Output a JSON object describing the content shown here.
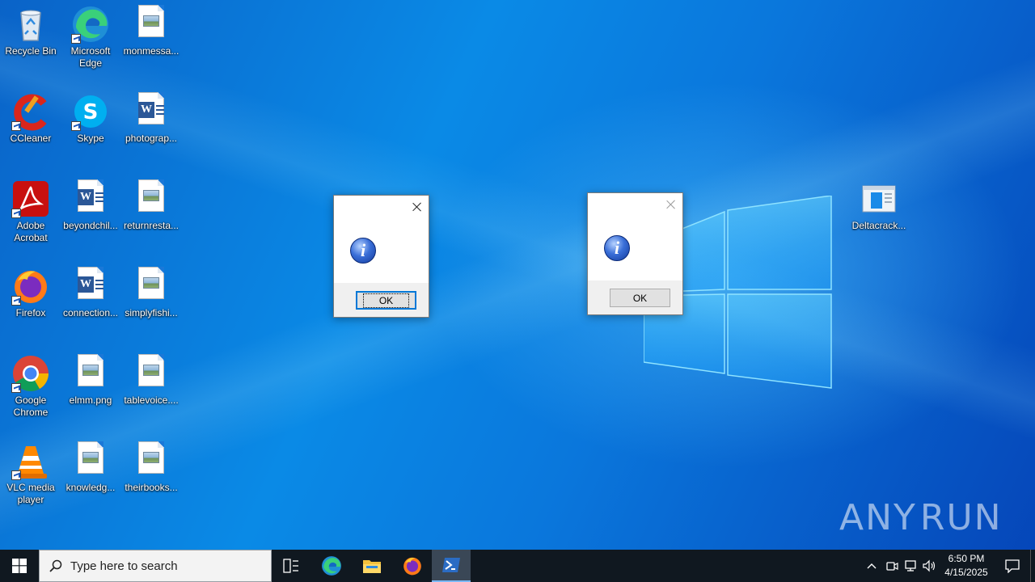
{
  "desktop": {
    "icons": [
      {
        "label": "Recycle Bin",
        "icon": "recycle-bin-icon"
      },
      {
        "label": "Microsoft Edge",
        "icon": "edge-icon"
      },
      {
        "label": "monmessa...",
        "icon": "image-file-icon"
      },
      {
        "label": "CCleaner",
        "icon": "ccleaner-icon"
      },
      {
        "label": "Skype",
        "icon": "skype-icon"
      },
      {
        "label": "photograp...",
        "icon": "word-doc-icon"
      },
      {
        "label": "Adobe Acrobat",
        "icon": "acrobat-icon"
      },
      {
        "label": "beyondchil...",
        "icon": "word-doc-icon"
      },
      {
        "label": "returnresta...",
        "icon": "image-file-icon"
      },
      {
        "label": "Firefox",
        "icon": "firefox-icon"
      },
      {
        "label": "connection...",
        "icon": "word-doc-icon"
      },
      {
        "label": "simplyfishi...",
        "icon": "image-file-icon"
      },
      {
        "label": "Google Chrome",
        "icon": "chrome-icon"
      },
      {
        "label": "elmm.png",
        "icon": "image-file-icon"
      },
      {
        "label": "tablevoice....",
        "icon": "image-file-icon"
      },
      {
        "label": "VLC media player",
        "icon": "vlc-icon"
      },
      {
        "label": "knowledg...",
        "icon": "image-file-icon"
      },
      {
        "label": "theirbooks...",
        "icon": "image-file-icon"
      },
      {
        "label": "Deltacrack...",
        "icon": "app-window-icon"
      }
    ]
  },
  "dialogs": [
    {
      "ok_label": "OK",
      "icon": "info-icon",
      "state": "active"
    },
    {
      "ok_label": "OK",
      "icon": "info-icon",
      "state": "inactive"
    }
  ],
  "watermark": {
    "text_left": "ANY",
    "text_right": "RUN"
  },
  "taskbar": {
    "search_placeholder": "Type here to search",
    "pinned": [
      "task-view",
      "edge",
      "file-explorer",
      "firefox",
      "powershell"
    ],
    "clock_time": "6:50 PM",
    "clock_date": "4/15/2025"
  },
  "colors": {
    "taskbar": "#101820",
    "wallpaper_blue": "#0a77dc",
    "accent": "#0078d7"
  }
}
